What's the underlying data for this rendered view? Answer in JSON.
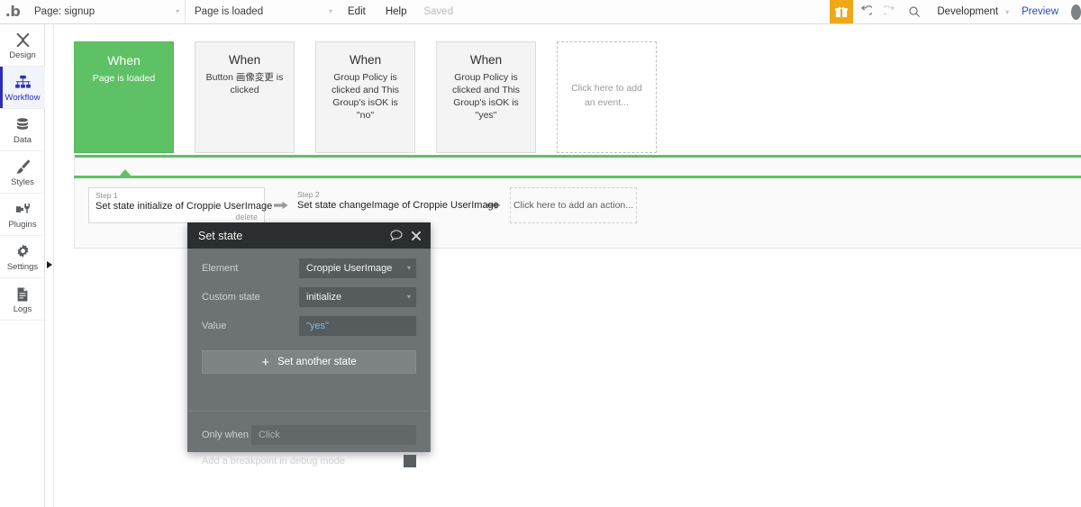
{
  "topbar": {
    "logo": "logo-b-icon",
    "page_selector": {
      "label": "Page: signup",
      "caret": "▾"
    },
    "event_selector": {
      "label": "Page is loaded",
      "caret": "▾"
    },
    "edit_label": "Edit",
    "help_label": "Help",
    "saved_label": "Saved",
    "gift_icon": "gift-icon",
    "undo_icon": "undo-icon",
    "redo_icon": "redo-icon",
    "search_icon": "search-icon",
    "version_label": "Development",
    "version_caret": "▾",
    "preview_label": "Preview",
    "accent_orange": "#f0a818",
    "preview_color": "#2a4bc4"
  },
  "sidebar": {
    "items": [
      {
        "label": "Design",
        "icon": "design-icon",
        "active": false
      },
      {
        "label": "Workflow",
        "icon": "workflow-icon",
        "active": true
      },
      {
        "label": "Data",
        "icon": "data-icon",
        "active": false
      },
      {
        "label": "Styles",
        "icon": "styles-icon",
        "active": false
      },
      {
        "label": "Plugins",
        "icon": "plugins-icon",
        "active": false
      },
      {
        "label": "Settings",
        "icon": "settings-icon",
        "active": false
      },
      {
        "label": "Logs",
        "icon": "logs-icon",
        "active": false
      }
    ],
    "active_color": "#2b2fb8",
    "expand_arrow": "expand-arrow-icon"
  },
  "workflow": {
    "accent_green": "#5fc165",
    "events": [
      {
        "when": "When",
        "desc": "Page is loaded",
        "selected": true
      },
      {
        "when": "When",
        "desc": "Button 画像変更 is clicked",
        "selected": false
      },
      {
        "when": "When",
        "desc": "Group Policy is clicked and This Group's isOK is \"no\"",
        "selected": false
      },
      {
        "when": "When",
        "desc": "Group Policy is clicked and This Group's isOK is \"yes\"",
        "selected": false
      }
    ],
    "add_event_placeholder": "Click here to add an event...",
    "steps": [
      {
        "number": "Step 1",
        "title": "Set state initialize of Croppie UserImage",
        "delete_label": "delete"
      },
      {
        "number": "Step 2",
        "title": "Set state changeImage of Croppie UserImage",
        "delete_label": ""
      }
    ],
    "step_arrow": "arrow-right-icon",
    "add_action_placeholder": "Click here to add an action...",
    "close_icon": "close-icon"
  },
  "property_editor": {
    "title": "Set state",
    "comment_icon": "comment-icon",
    "close_icon": "close-icon",
    "fields": [
      {
        "label": "Element",
        "value": "Croppie UserImage",
        "type": "dropdown"
      },
      {
        "label": "Custom state",
        "value": "initialize",
        "type": "dropdown"
      },
      {
        "label": "Value",
        "value": "\"yes\"",
        "type": "expression"
      }
    ],
    "set_another_state_label": "Set another state",
    "plus_icon": "plus-icon",
    "only_when_label": "Only when",
    "only_when_placeholder": "Click",
    "breakpoint_label": "Add a breakpoint in debug mode",
    "breakpoint_checked": false,
    "value_color": "#8db4dc"
  }
}
